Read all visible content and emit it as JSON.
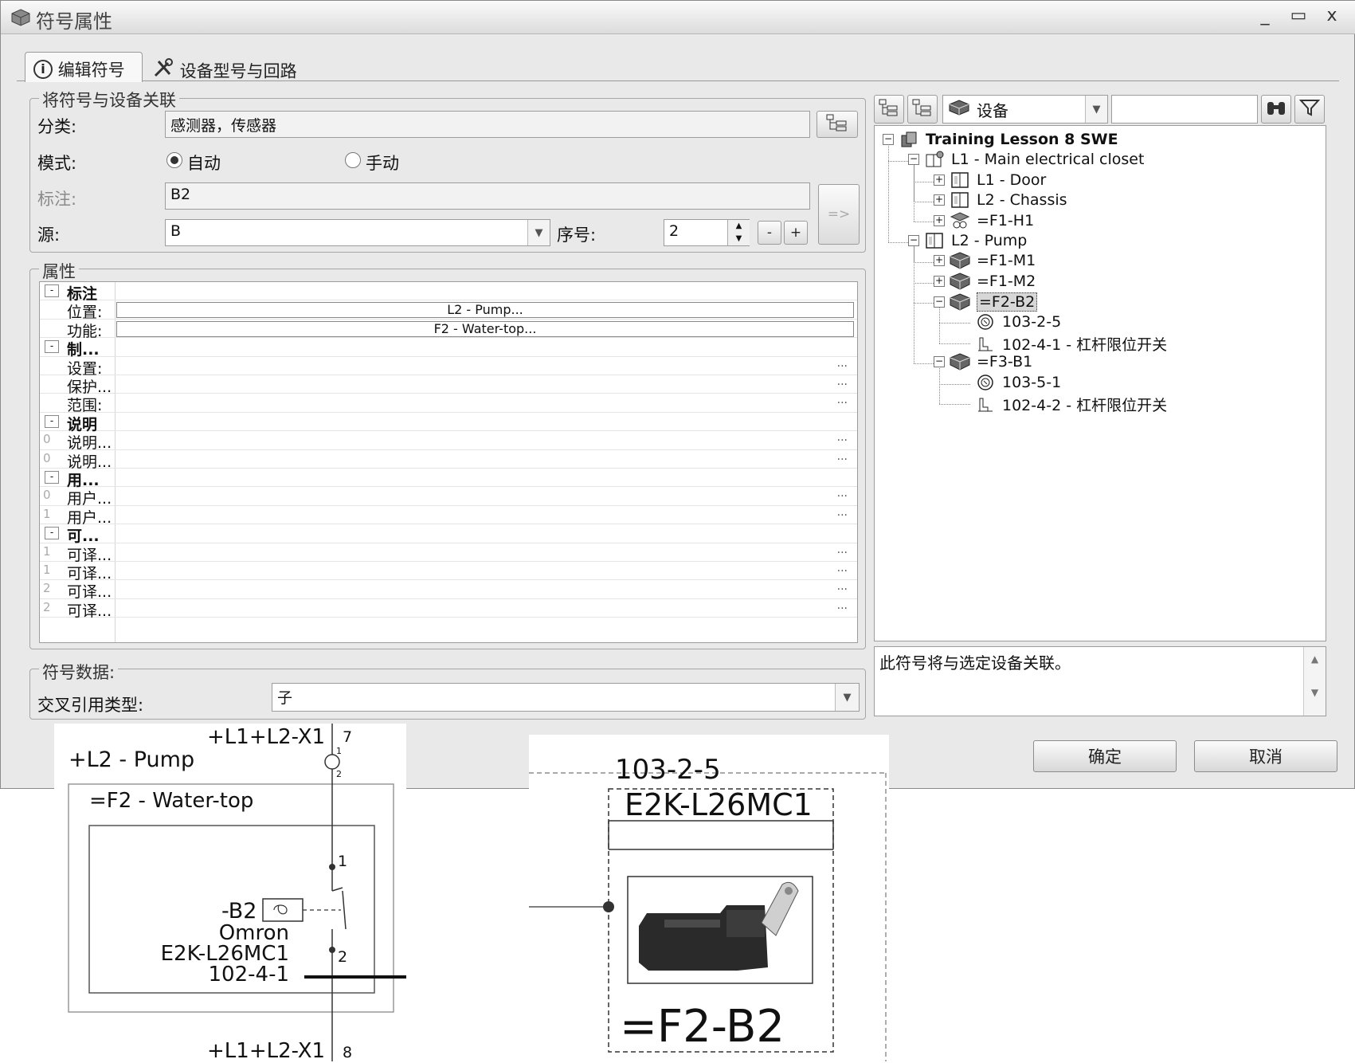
{
  "window": {
    "title": "符号属性",
    "minimize": "_",
    "maximize": "▭",
    "close": "x"
  },
  "tabs": [
    {
      "label": "编辑符号"
    },
    {
      "label": "设备型号与回路"
    }
  ],
  "associate": {
    "legend": "将符号与设备关联",
    "category_label": "分类:",
    "category_value": "感测器，传感器",
    "mode_label": "模式:",
    "mode_auto": "自动",
    "mode_manual": "手动",
    "mark_label": "标注:",
    "mark_value": "B2",
    "source_label": "源:",
    "source_value": "B",
    "seq_label": "序号:",
    "seq_value": "2",
    "minus": "-",
    "plus": "+",
    "assign": "=>"
  },
  "properties": {
    "legend": "属性",
    "rows": [
      {
        "idx": "",
        "name": "标注",
        "group": true,
        "value": "",
        "dots": false
      },
      {
        "idx": "",
        "name": "位置:",
        "group": false,
        "value": "L2 - Pump...",
        "dots": false
      },
      {
        "idx": "",
        "name": "功能:",
        "group": false,
        "value": "F2 - Water-top...",
        "dots": false
      },
      {
        "idx": "",
        "name": "制...",
        "group": true,
        "value": "",
        "dots": false
      },
      {
        "idx": "",
        "name": "设置:",
        "group": false,
        "value": "",
        "dots": true
      },
      {
        "idx": "",
        "name": "保护...",
        "group": false,
        "value": "",
        "dots": true
      },
      {
        "idx": "",
        "name": "范围:",
        "group": false,
        "value": "",
        "dots": true
      },
      {
        "idx": "",
        "name": "说明",
        "group": true,
        "value": "",
        "dots": false
      },
      {
        "idx": "0",
        "name": "说明...",
        "group": false,
        "value": "",
        "dots": true
      },
      {
        "idx": "0",
        "name": "说明...",
        "group": false,
        "value": "",
        "dots": true
      },
      {
        "idx": "",
        "name": "用...",
        "group": true,
        "value": "",
        "dots": false
      },
      {
        "idx": "0",
        "name": "用户...",
        "group": false,
        "value": "",
        "dots": true
      },
      {
        "idx": "1",
        "name": "用户...",
        "group": false,
        "value": "",
        "dots": true
      },
      {
        "idx": "",
        "name": "可...",
        "group": true,
        "value": "",
        "dots": false
      },
      {
        "idx": "1",
        "name": "可译...",
        "group": false,
        "value": "",
        "dots": true
      },
      {
        "idx": "1",
        "name": "可译...",
        "group": false,
        "value": "",
        "dots": true
      },
      {
        "idx": "2",
        "name": "可译...",
        "group": false,
        "value": "",
        "dots": true
      },
      {
        "idx": "2",
        "name": "可译...",
        "group": false,
        "value": "",
        "dots": true
      }
    ]
  },
  "symbol_data": {
    "legend": "符号数据:",
    "xref_label": "交叉引用类型:",
    "xref_value": "子"
  },
  "tree": {
    "filter_value": "设备",
    "search_value": "",
    "nodes": [
      {
        "label": "Training Lesson 8 SWE",
        "level": 0,
        "toggle": "−",
        "icon": "project",
        "bold": true,
        "selected": false
      },
      {
        "label": "L1 - Main electrical closet",
        "level": 1,
        "toggle": "−",
        "icon": "location",
        "bold": false,
        "selected": false
      },
      {
        "label": "L1 - Door",
        "level": 2,
        "toggle": "+",
        "icon": "cabinet",
        "bold": false,
        "selected": false
      },
      {
        "label": "L2 - Chassis",
        "level": 2,
        "toggle": "+",
        "icon": "cabinet",
        "bold": false,
        "selected": false
      },
      {
        "label": "=F1-H1",
        "level": 2,
        "toggle": "+",
        "icon": "lamp",
        "bold": false,
        "selected": false
      },
      {
        "label": "L2 - Pump",
        "level": 1,
        "toggle": "−",
        "icon": "cabinet",
        "bold": false,
        "selected": false
      },
      {
        "label": "=F1-M1",
        "level": 2,
        "toggle": "+",
        "icon": "device",
        "bold": false,
        "selected": false
      },
      {
        "label": "=F1-M2",
        "level": 2,
        "toggle": "+",
        "icon": "device",
        "bold": false,
        "selected": false
      },
      {
        "label": "=F2-B2",
        "level": 2,
        "toggle": "−",
        "icon": "device",
        "bold": false,
        "selected": true
      },
      {
        "label": "103-2-5",
        "level": 3,
        "toggle": "",
        "icon": "sensor",
        "bold": false,
        "selected": false
      },
      {
        "label": "102-4-1 - 杠杆限位开关",
        "level": 3,
        "toggle": "",
        "icon": "switch",
        "bold": false,
        "selected": false
      },
      {
        "label": "=F3-B1",
        "level": 2,
        "toggle": "−",
        "icon": "device",
        "bold": false,
        "selected": false
      },
      {
        "label": "103-5-1",
        "level": 3,
        "toggle": "",
        "icon": "sensor",
        "bold": false,
        "selected": false
      },
      {
        "label": "102-4-2 - 杠杆限位开关",
        "level": 3,
        "toggle": "",
        "icon": "switch",
        "bold": false,
        "selected": false
      }
    ]
  },
  "info_text": "此符号将与选定设备关联。",
  "buttons": {
    "ok": "确定",
    "cancel": "取消"
  },
  "schematic_left": {
    "top_terminal": "+L1+L2-X1",
    "top_pin": "7",
    "location": "+L2 - Pump",
    "function": "=F2 - Water-top",
    "pin1": "1",
    "pin2": "2",
    "term_pin_a": "1",
    "term_pin_b": "2",
    "tag": "-B2",
    "maker": "Omron",
    "part": "E2K-L26MC1",
    "ref": "102-4-1",
    "bottom_terminal": "+L1+L2-X1",
    "bottom_pin": "8"
  },
  "schematic_right": {
    "ref": "103-2-5",
    "part": "E2K-L26MC1",
    "tag": "=F2-B2"
  },
  "colors": {
    "window_bg": "#e9e9e9",
    "selection": "#d7d7d7"
  }
}
